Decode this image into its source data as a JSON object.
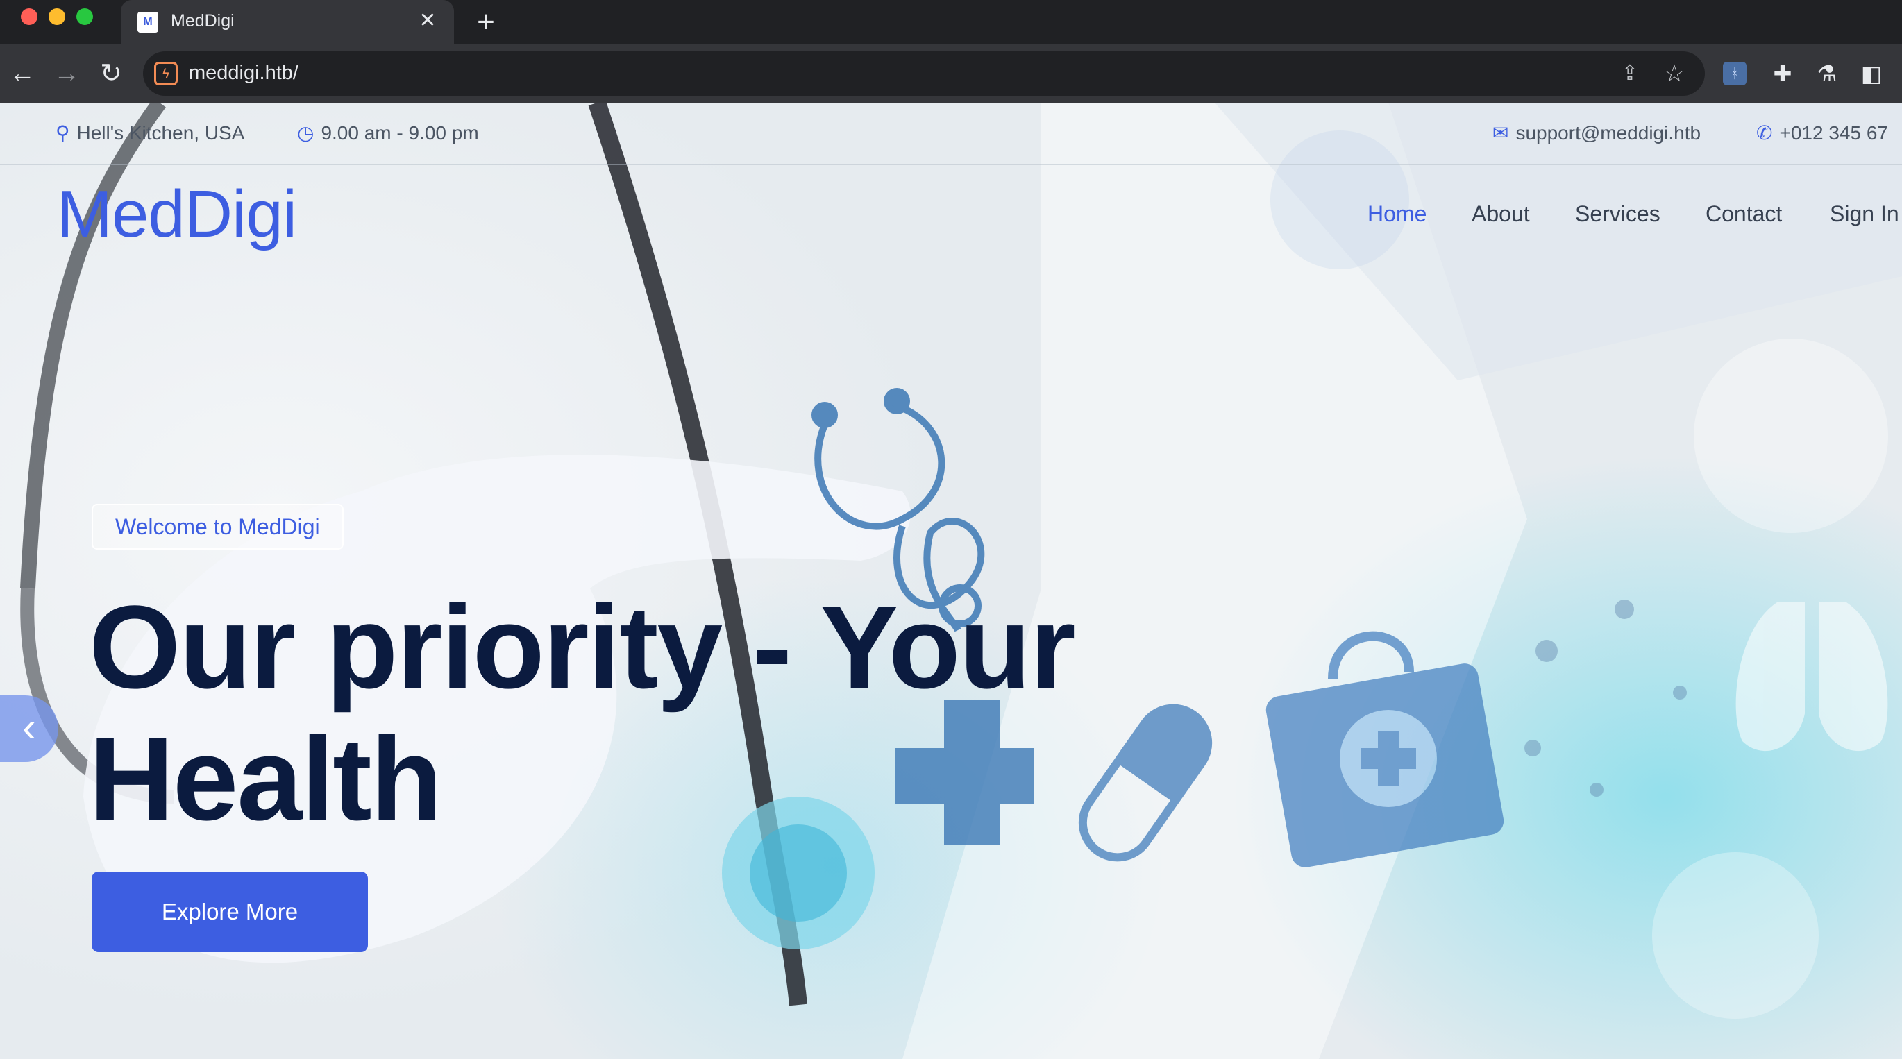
{
  "browser": {
    "tab_title": "MedDigi",
    "tab_favicon": "M",
    "tab_close": "✕",
    "new_tab": "+",
    "url": "meddigi.htb/",
    "icons": {
      "back": "←",
      "forward": "→",
      "reload": "↻",
      "site_info": "ϟ",
      "share": "⇪",
      "bookmark": "☆",
      "extension_1": "ᚼ",
      "extensions": "✚",
      "labs": "⚗",
      "side_panel": "◧"
    }
  },
  "topbar": {
    "location": "Hell's Kitchen, USA",
    "hours": "9.00 am - 9.00 pm",
    "email": "support@meddigi.htb",
    "phone": "+012 345 67",
    "icons": {
      "location": "⚲",
      "clock": "◷",
      "mail": "✉",
      "phone": "✆"
    }
  },
  "navbar": {
    "brand": "MedDigi",
    "items": [
      "Home",
      "About",
      "Services",
      "Contact",
      "Sign In"
    ],
    "active": "Home"
  },
  "hero": {
    "badge": "Welcome to MedDigi",
    "headline_line1": "Our priority - Your",
    "headline_line2": "Health",
    "cta": "Explore More",
    "prev_icon": "‹"
  },
  "colors": {
    "accent": "#3d5ee1",
    "headline": "#0b1b3f",
    "chrome_dark": "#202124",
    "chrome_toolbar": "#35363a"
  }
}
